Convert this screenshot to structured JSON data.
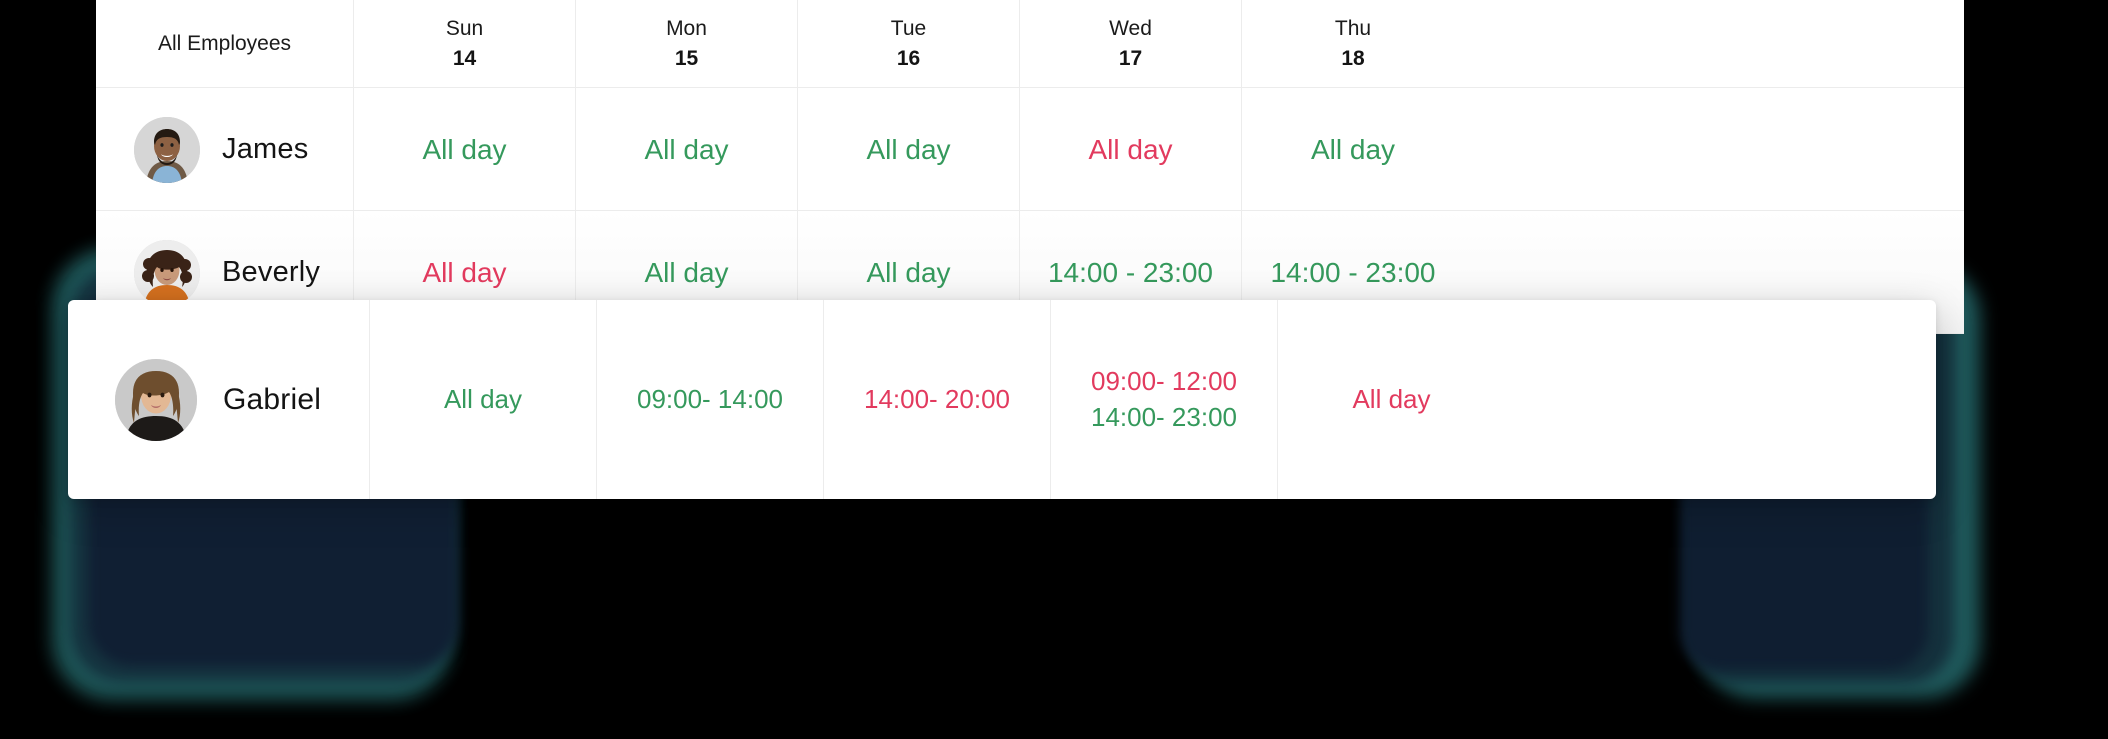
{
  "table": {
    "columns": {
      "employee_header": "All Employees",
      "days": [
        {
          "dow": "Sun",
          "dom": "14"
        },
        {
          "dow": "Mon",
          "dom": "15"
        },
        {
          "dow": "Tue",
          "dom": "16"
        },
        {
          "dow": "Wed",
          "dom": "17"
        },
        {
          "dow": "Thu",
          "dom": "18"
        }
      ]
    },
    "rows": [
      {
        "name": "James",
        "avatar": "avatar-james",
        "shifts": [
          {
            "lines": [
              {
                "text": "All day",
                "color": "green"
              }
            ]
          },
          {
            "lines": [
              {
                "text": "All day",
                "color": "green"
              }
            ]
          },
          {
            "lines": [
              {
                "text": "All day",
                "color": "green"
              }
            ]
          },
          {
            "lines": [
              {
                "text": "All day",
                "color": "red"
              }
            ]
          },
          {
            "lines": [
              {
                "text": "All day",
                "color": "green"
              }
            ]
          }
        ]
      },
      {
        "name": "Beverly",
        "avatar": "avatar-beverly",
        "shifts": [
          {
            "lines": [
              {
                "text": "All day",
                "color": "red"
              }
            ]
          },
          {
            "lines": [
              {
                "text": "All day",
                "color": "green"
              }
            ]
          },
          {
            "lines": [
              {
                "text": "All day",
                "color": "green"
              }
            ]
          },
          {
            "lines": [
              {
                "text": "14:00 - 23:00",
                "color": "green"
              }
            ]
          },
          {
            "lines": [
              {
                "text": "14:00 - 23:00",
                "color": "green"
              }
            ]
          }
        ]
      }
    ],
    "floating_row": {
      "name": "Gabriel",
      "avatar": "avatar-gabriel",
      "shifts": [
        {
          "lines": [
            {
              "text": "All day",
              "color": "green"
            }
          ]
        },
        {
          "lines": [
            {
              "text": "09:00- 14:00",
              "color": "green"
            }
          ]
        },
        {
          "lines": [
            {
              "text": "14:00- 20:00",
              "color": "red"
            }
          ]
        },
        {
          "lines": [
            {
              "text": "09:00- 12:00",
              "color": "red"
            },
            {
              "text": "14:00- 23:00",
              "color": "green"
            }
          ]
        },
        {
          "lines": [
            {
              "text": "All day",
              "color": "red"
            }
          ]
        }
      ]
    }
  },
  "colors": {
    "available": "#35995c",
    "unavailable": "#e23a5e",
    "background": "#000000",
    "glow": "#1f5a5c",
    "card": "#ffffff",
    "grid_line": "#ececec"
  }
}
